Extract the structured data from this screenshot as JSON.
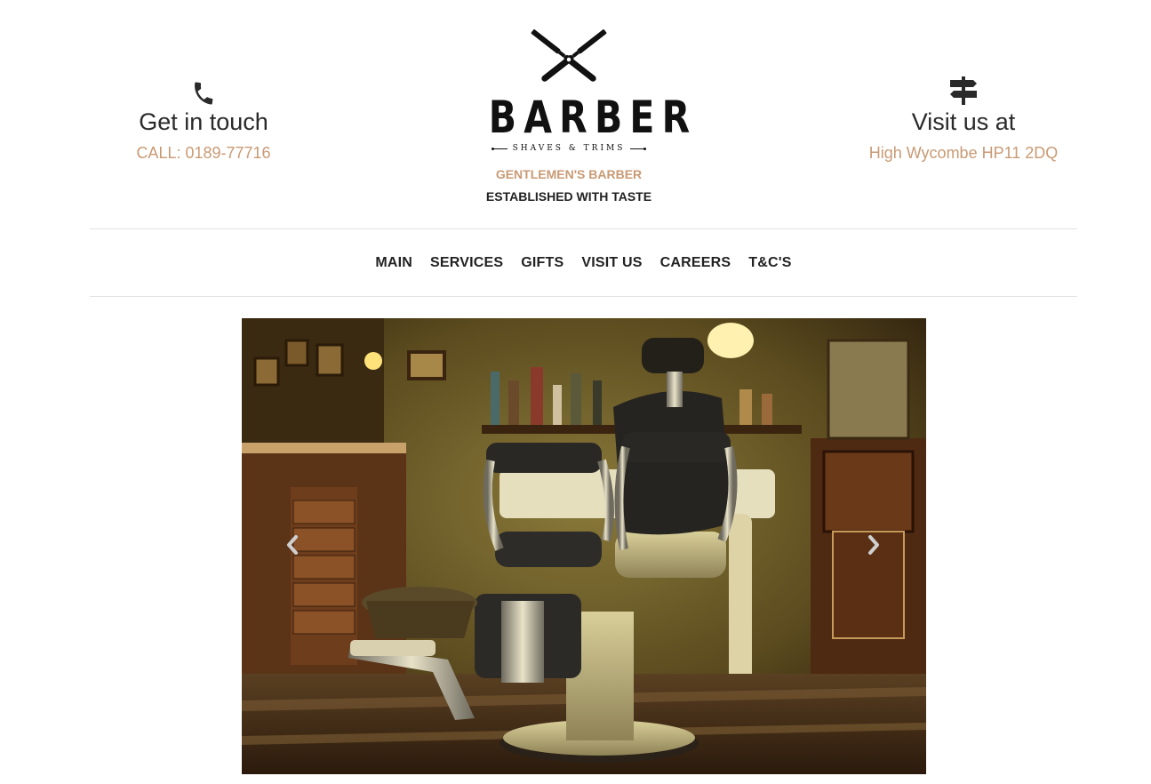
{
  "header": {
    "contact_left": {
      "icon": "phone-icon",
      "title": "Get in touch",
      "detail": "CALL: 0189-77716"
    },
    "contact_right": {
      "icon": "signpost-icon",
      "title": "Visit us at",
      "detail": "High Wycombe HP11 2DQ"
    },
    "logo": {
      "icon": "crossed-razors-icon",
      "word": "BARBER",
      "subline": "SHAVES & TRIMS"
    },
    "tagline_1": "GENTLEMEN'S BARBER",
    "tagline_2": "ESTABLISHED WITH TASTE"
  },
  "nav": {
    "items": [
      {
        "label": "MAIN"
      },
      {
        "label": "SERVICES"
      },
      {
        "label": "GIFTS"
      },
      {
        "label": "VISIT US"
      },
      {
        "label": "CAREERS"
      },
      {
        "label": "T&C'S"
      }
    ]
  },
  "carousel": {
    "image": "barber-chair-photo",
    "prev_icon": "chevron-left-icon",
    "next_icon": "chevron-right-icon"
  },
  "colors": {
    "accent": "#c99a74",
    "text": "#222222",
    "divider": "#e2e2e2"
  }
}
